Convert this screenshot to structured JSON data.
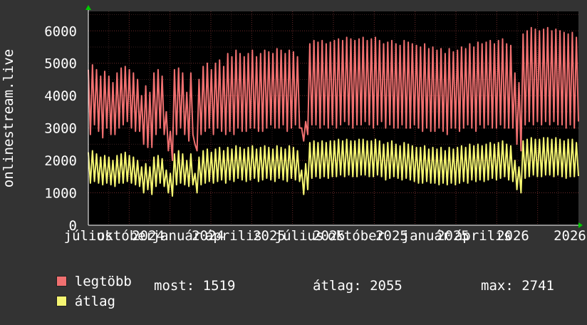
{
  "chart_data": {
    "type": "line",
    "ylabel": "onlinestream.live",
    "ylim": [
      0,
      6600
    ],
    "yticks": [
      0,
      1000,
      2000,
      3000,
      4000,
      5000,
      6000
    ],
    "ytick_labels": [
      "0",
      "1000",
      "2000",
      "3000",
      "4000",
      "5000",
      "6000"
    ],
    "xtick_labels": [
      "július",
      "október",
      "2024",
      "január",
      "2024",
      "április",
      "2025",
      "július",
      "2025",
      "október",
      "2025",
      "január",
      "2025",
      "április",
      "2026",
      "2026"
    ],
    "grid": true,
    "legend_position": "bottom",
    "series": [
      {
        "name": "legtöbb",
        "color": "#f07070",
        "values": [
          4800,
          4950,
          4800,
          4600,
          4750,
          4600,
          4400,
          4700,
          4850,
          4900,
          4800,
          4700,
          4500,
          4000,
          4300,
          4100,
          4700,
          4800,
          4600,
          3500,
          2900,
          4800,
          4850,
          4700,
          4100,
          4700,
          2500,
          4500,
          4900,
          5000,
          4800,
          5000,
          5100,
          4900,
          5300,
          5200,
          5400,
          5300,
          5200,
          5300,
          5400,
          5200,
          5300,
          5400,
          5350,
          5300,
          5450,
          5400,
          5300,
          5400,
          5350,
          5200,
          3000,
          3200,
          5600,
          5700,
          5650,
          5700,
          5600,
          5650,
          5700,
          5750,
          5700,
          5800,
          5750,
          5700,
          5750,
          5800,
          5700,
          5750,
          5800,
          5700,
          5600,
          5650,
          5700,
          5600,
          5550,
          5700,
          5650,
          5600,
          5550,
          5500,
          5600,
          5450,
          5500,
          5400,
          5450,
          5300,
          5450,
          5350,
          5400,
          5500,
          5450,
          5600,
          5500,
          5650,
          5600,
          5650,
          5700,
          5600,
          5700,
          5750,
          5600,
          5550,
          4700,
          4400,
          5900,
          6000,
          6100,
          6050,
          6000,
          6050,
          6100,
          6000,
          6050,
          6000,
          5950,
          5900,
          5950,
          5800
        ],
        "min_values": [
          2800,
          3100,
          2900,
          2700,
          3000,
          2800,
          2800,
          3000,
          3100,
          3200,
          3000,
          2900,
          2900,
          2500,
          2400,
          2400,
          2800,
          3000,
          2800,
          2300,
          2000,
          2800,
          3000,
          2800,
          2600,
          2800,
          2300,
          2800,
          2900,
          3000,
          2800,
          3000,
          2900,
          2800,
          2900,
          2800,
          3000,
          2900,
          2900,
          3000,
          3000,
          2900,
          2900,
          3000,
          3100,
          3000,
          3000,
          3100,
          2900,
          3000,
          3100,
          3000,
          2600,
          2800,
          3100,
          3100,
          3000,
          3100,
          3000,
          3100,
          3000,
          3100,
          3200,
          3100,
          3000,
          3100,
          3100,
          3200,
          3100,
          3000,
          3100,
          3200,
          3000,
          3100,
          3000,
          3000,
          3100,
          3000,
          3000,
          3100,
          3000,
          2900,
          3000,
          2900,
          2900,
          3000,
          2900,
          2800,
          3000,
          3000,
          2900,
          3000,
          3100,
          3000,
          2900,
          3100,
          3000,
          3100,
          3000,
          3000,
          3100,
          3000,
          3000,
          3000,
          2500,
          2300,
          3100,
          3200,
          3100,
          3200,
          3100,
          3200,
          3100,
          3200,
          3100,
          3100,
          3000,
          3100,
          3000,
          3200
        ]
      },
      {
        "name": "átlag",
        "color": "#f5f572",
        "values": [
          2250,
          2300,
          2200,
          2100,
          2150,
          2100,
          2000,
          2150,
          2200,
          2250,
          2150,
          2100,
          2000,
          1800,
          1900,
          1800,
          2100,
          2150,
          2050,
          1700,
          1600,
          2200,
          2300,
          2200,
          2000,
          2200,
          1600,
          2100,
          2300,
          2350,
          2250,
          2350,
          2400,
          2300,
          2400,
          2350,
          2450,
          2400,
          2350,
          2400,
          2450,
          2350,
          2400,
          2450,
          2400,
          2350,
          2450,
          2400,
          2350,
          2450,
          2400,
          2300,
          1700,
          1900,
          2550,
          2600,
          2550,
          2600,
          2550,
          2600,
          2600,
          2650,
          2600,
          2650,
          2600,
          2600,
          2650,
          2650,
          2600,
          2600,
          2650,
          2600,
          2500,
          2550,
          2600,
          2500,
          2450,
          2550,
          2500,
          2450,
          2400,
          2400,
          2450,
          2350,
          2400,
          2350,
          2400,
          2300,
          2400,
          2350,
          2400,
          2450,
          2400,
          2500,
          2450,
          2500,
          2450,
          2500,
          2550,
          2500,
          2550,
          2600,
          2500,
          2450,
          2000,
          1800,
          2600,
          2650,
          2700,
          2650,
          2650,
          2700,
          2700,
          2650,
          2700,
          2650,
          2600,
          2650,
          2650,
          2550
        ],
        "min_values": [
          1300,
          1350,
          1300,
          1250,
          1300,
          1250,
          1200,
          1300,
          1300,
          1350,
          1300,
          1250,
          1200,
          1000,
          1100,
          950,
          1200,
          1300,
          1200,
          1000,
          900,
          1250,
          1300,
          1250,
          1200,
          1250,
          1000,
          1250,
          1300,
          1350,
          1300,
          1350,
          1400,
          1300,
          1400,
          1350,
          1450,
          1400,
          1350,
          1400,
          1450,
          1350,
          1400,
          1450,
          1400,
          1350,
          1450,
          1400,
          1350,
          1450,
          1400,
          1350,
          950,
          1100,
          1450,
          1500,
          1450,
          1500,
          1450,
          1500,
          1500,
          1550,
          1500,
          1550,
          1500,
          1500,
          1550,
          1550,
          1500,
          1500,
          1550,
          1500,
          1400,
          1450,
          1500,
          1450,
          1400,
          1450,
          1400,
          1350,
          1300,
          1300,
          1350,
          1300,
          1300,
          1250,
          1300,
          1250,
          1300,
          1250,
          1300,
          1350,
          1300,
          1400,
          1350,
          1400,
          1350,
          1400,
          1450,
          1400,
          1450,
          1500,
          1400,
          1350,
          1100,
          1000,
          1450,
          1500,
          1550,
          1500,
          1500,
          1550,
          1550,
          1500,
          1550,
          1500,
          1450,
          1500,
          1500,
          1519
        ]
      }
    ]
  },
  "legend": {
    "items": [
      {
        "label": "legtöbb",
        "color": "#f07070"
      },
      {
        "label": "átlag",
        "color": "#f5f572"
      }
    ]
  },
  "stats": {
    "now": "most: 1519",
    "avg": "átlag: 2055",
    "max": "max: 2741"
  }
}
